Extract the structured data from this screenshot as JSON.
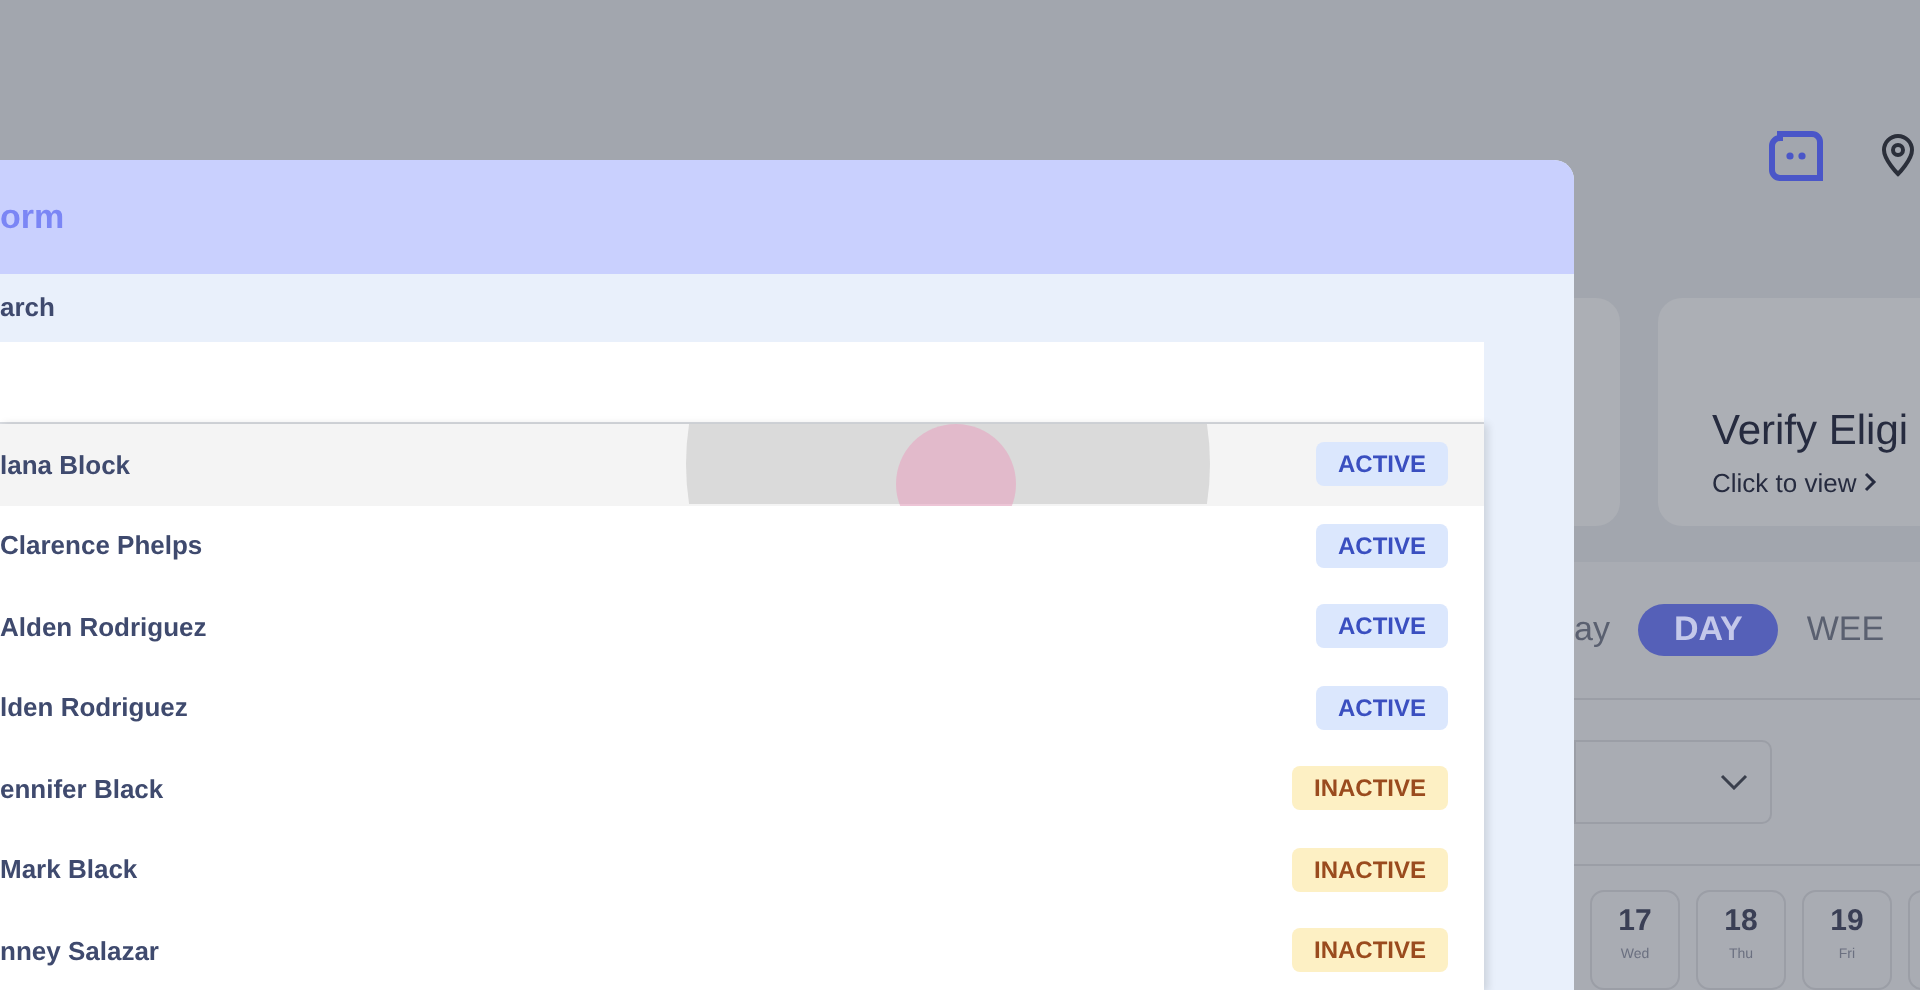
{
  "modal": {
    "title": "orm",
    "search_label": "arch",
    "options": [
      {
        "name": "lana Block",
        "kind": "active",
        "label": "ACTIVE",
        "selected": true
      },
      {
        "name": "Clarence Phelps",
        "kind": "active",
        "label": "ACTIVE",
        "selected": false
      },
      {
        "name": "Alden Rodriguez",
        "kind": "active",
        "label": "ACTIVE",
        "selected": false
      },
      {
        "name": "lden Rodriguez",
        "kind": "active",
        "label": "ACTIVE",
        "selected": false
      },
      {
        "name": "ennifer Black",
        "kind": "inactive",
        "label": "INACTIVE",
        "selected": false
      },
      {
        "name": "Mark Black",
        "kind": "inactive",
        "label": "INACTIVE",
        "selected": false
      },
      {
        "name": "nney Salazar",
        "kind": "inactive",
        "label": "INACTIVE",
        "selected": false
      }
    ]
  },
  "background": {
    "card": {
      "title": "Verify Eligi",
      "link": "Click to view"
    },
    "view_tabs": [
      {
        "label": "ay",
        "selected": false
      },
      {
        "label": "DAY",
        "selected": true
      },
      {
        "label": "WEE",
        "selected": false
      }
    ],
    "dates": [
      {
        "day": "17",
        "weekday": "Wed"
      },
      {
        "day": "18",
        "weekday": "Thu"
      },
      {
        "day": "19",
        "weekday": "Fri"
      }
    ]
  }
}
